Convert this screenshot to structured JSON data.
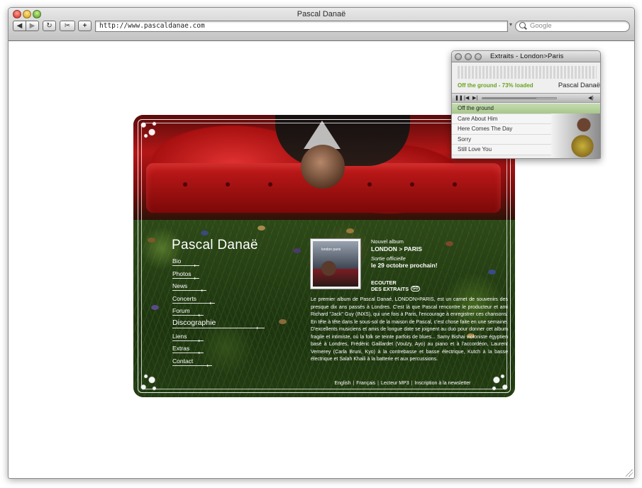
{
  "browser": {
    "title": "Pascal Danaë",
    "url": "http://www.pascaldanae.com",
    "search_placeholder": "Google",
    "back_glyph": "◀",
    "forward_glyph": "▶",
    "reload_glyph": "↻",
    "snip_glyph": "✂",
    "add_glyph": "+"
  },
  "site": {
    "name": "Pascal Danaë",
    "nav": [
      {
        "label": "Bio"
      },
      {
        "label": "Photos"
      },
      {
        "label": "News"
      },
      {
        "label": "Concerts"
      },
      {
        "label": "Forum"
      },
      {
        "label": "Discographie"
      },
      {
        "label": "Liens"
      },
      {
        "label": "Extras"
      },
      {
        "label": "Contact"
      }
    ],
    "album_cover_text": "london paris",
    "news_label": "Nouvel album",
    "news_title": "LONDON > PARIS",
    "release_label": "Sortie officielle",
    "release_date": "le 29 octobre prochain!",
    "listen_line1": "ECOUTER",
    "listen_line2": "DES EXTRAITS",
    "go_label": "GO",
    "bio_text": "Le premier album de Pascal Danaé, LONDON>PARIS, est un carnet de souvenirs des presque dix ans passés à Londres. C'est là que Pascal rencontre le producteur et ami Richard \"Jack\" Guy (INXS), qui une fois à Paris, l'encourage à enregistrer ces chansons. En tête à tête dans le sous-sol de la maison de Pascal, c'est chose faite en une semaine. D'excellents musiciens et amis de longue date se joignent au duo pour donner cet album fragile et intimiste, où la folk se teinte parfois de blues... Samy Bishai violoniste égyptien basé à Londres, Frédéric Gaillardet (Voulzy, Ayo) au piano et à l'accordéon, Laurent Vernerey (Carla Bruni, Kyo) à la contrebasse et basse électrique, Kutch à la basse électrique et Salah Khaili à la batterie et aux percussions.",
    "footer_links": [
      {
        "label": "English"
      },
      {
        "label": "Français"
      },
      {
        "label": "Lecteur MP3"
      },
      {
        "label": "Inscription à la newsletter"
      }
    ],
    "footer_separator": "|"
  },
  "player": {
    "title": "Extraits - London>Paris",
    "status": "Off the ground - 73% loaded",
    "loaded_fraction": 0.73,
    "artist": "Pascal Danaë",
    "pause_glyph": "❚❚",
    "prev_glyph": "|◀",
    "next_glyph": "▶|",
    "volume_glyph": "◀)",
    "tracks": [
      {
        "title": "Off the ground",
        "active": true
      },
      {
        "title": "Care About Him",
        "active": false
      },
      {
        "title": "Here Comes The Day",
        "active": false
      },
      {
        "title": "Sorry",
        "active": false
      },
      {
        "title": "Still Love You",
        "active": false
      }
    ]
  },
  "colors": {
    "accent_green": "#6ba21f",
    "sofa_red": "#b31616",
    "grass_green": "#2f4a1a"
  }
}
